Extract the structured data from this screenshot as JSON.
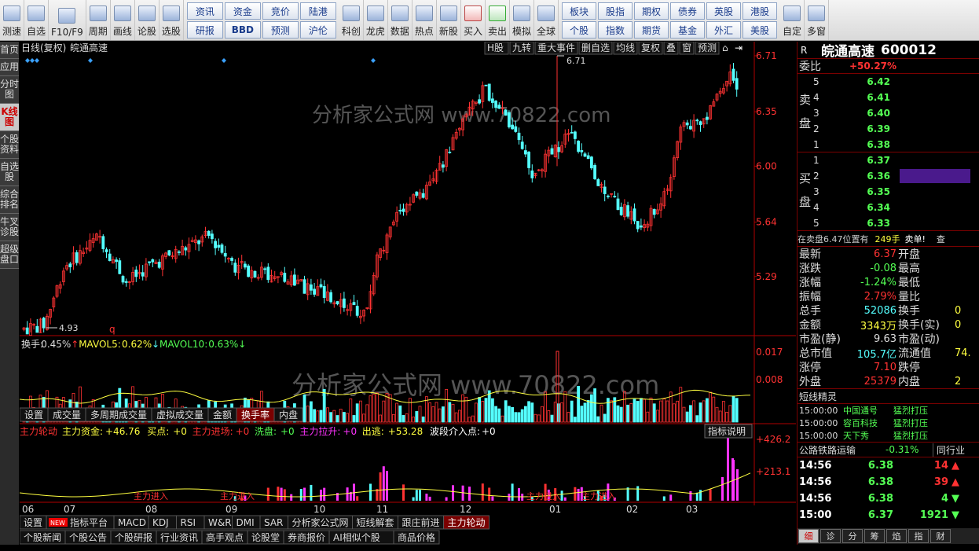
{
  "toolbar": {
    "left_buttons": [
      {
        "label": "测速",
        "icon": "speed-test-icon"
      },
      {
        "label": "自选",
        "icon": "star-icon"
      },
      {
        "label": "F10/F9",
        "icon": "document-icon"
      },
      {
        "label": "周期",
        "icon": "clock-icon"
      },
      {
        "label": "画线",
        "icon": "pencil-icon"
      },
      {
        "label": "论股",
        "icon": "discussion-icon"
      },
      {
        "label": "选股",
        "icon": "stock-picker-icon"
      }
    ],
    "grid1": [
      "资讯",
      "资金",
      "竞价",
      "陆港",
      "研报",
      "BBD",
      "预测",
      "沪伦"
    ],
    "mid_buttons": [
      {
        "label": "科创",
        "icon": "kechuang-icon"
      },
      {
        "label": "龙虎",
        "icon": "dragon-tiger-icon"
      },
      {
        "label": "数据",
        "icon": "pe-data-icon"
      },
      {
        "label": "热点",
        "icon": "hot-icon"
      },
      {
        "label": "新股",
        "icon": "ipo-icon"
      },
      {
        "label": "买入",
        "icon": "buy-icon"
      },
      {
        "label": "卖出",
        "icon": "sell-icon"
      },
      {
        "label": "模拟",
        "icon": "hammer-icon"
      },
      {
        "label": "全球",
        "icon": "globe-icon"
      }
    ],
    "grid2": [
      "板块",
      "股指",
      "期权",
      "债券",
      "英股",
      "港股",
      "个股",
      "指数",
      "期货",
      "基金",
      "外汇",
      "美股"
    ],
    "right_buttons": [
      {
        "label": "自定",
        "icon": "customize-icon"
      },
      {
        "label": "多窗",
        "icon": "multi-window-icon"
      }
    ]
  },
  "left_tabs": [
    "首页",
    "应用",
    "分时图",
    "K线图",
    "个股资料",
    "自选股",
    "综合排名",
    "牛叉诊股",
    "超级盘口"
  ],
  "chart": {
    "title": "日线(复权)",
    "stock": "皖通高速",
    "top_menu": [
      "H股",
      "九转",
      "重大事件",
      "删自选",
      "均线",
      "复权",
      "叠",
      "窗",
      "预测"
    ],
    "watermark": "分析家公式网 www.70822.com",
    "price_axis": [
      "6.71",
      "6.35",
      "6.00",
      "5.64",
      "5.29"
    ],
    "high_label": "6.71",
    "low_label": "4.93",
    "low_marker": "q",
    "months": [
      "06",
      "07",
      "08",
      "09",
      "10",
      "11",
      "12",
      "01",
      "02",
      "03"
    ],
    "vol_legend": {
      "label": "换手:",
      "value": "0.45%",
      "ma5_label": "MAVOL5:",
      "ma5": "0.62%",
      "ma10_label": "MAVOL10:",
      "ma10": "0.63%"
    },
    "vol_axis": [
      "0.017",
      "0.008"
    ],
    "vol_tabs": [
      "设置",
      "成交量",
      "多周期成交量",
      "虚拟成交量",
      "金额",
      "换手率",
      "内盘"
    ],
    "vol_active": "换手率",
    "ind_legend": {
      "name": "主力轮动",
      "items": [
        {
          "k": "主力资金:",
          "v": "+46.76"
        },
        {
          "k": "买点:",
          "v": "+0"
        },
        {
          "k": "主力进场:",
          "v": "+0"
        },
        {
          "k": "洗盘:",
          "v": "+0"
        },
        {
          "k": "主力拉升:",
          "v": "+0"
        },
        {
          "k": "出逃:",
          "v": "+53.28"
        },
        {
          "k": "波段介入点:",
          "v": "+0"
        }
      ]
    },
    "ind_button": "指标说明",
    "ind_axis": [
      "+426.2",
      "+213.1"
    ],
    "ind_marks": [
      "主力进入",
      "主力进入",
      "主力进入",
      "主力进入"
    ],
    "ind_tabs": [
      "设置",
      "指标平台",
      "MACD",
      "KDJ",
      "RSI",
      "W&R",
      "DMI",
      "SAR",
      "分析家公式网",
      "短线解套",
      "跟庄前进",
      "主力轮动"
    ],
    "ind_new_badge": "NEW",
    "ind_active": "主力轮动",
    "news_tabs": [
      "个股新闻",
      "个股公告",
      "个股研报",
      "行业资讯",
      "高手观点",
      "论股堂",
      "券商报价",
      "AI相似个股",
      "商品价格"
    ],
    "chart_data": {
      "type": "candlestick",
      "price_range": [
        4.93,
        6.71
      ]
    }
  },
  "quote": {
    "code_prefix": "R",
    "name": "皖通高速",
    "code": "600012",
    "weibi_label": "委比",
    "weibi": "+50.27%",
    "sell_label": "卖盘",
    "buy_label": "买盘",
    "sell": [
      {
        "lvl": "5",
        "price": "6.42"
      },
      {
        "lvl": "4",
        "price": "6.41"
      },
      {
        "lvl": "3",
        "price": "6.40"
      },
      {
        "lvl": "2",
        "price": "6.39"
      },
      {
        "lvl": "1",
        "price": "6.38"
      }
    ],
    "buy": [
      {
        "lvl": "1",
        "price": "6.37"
      },
      {
        "lvl": "2",
        "price": "6.36"
      },
      {
        "lvl": "3",
        "price": "6.35"
      },
      {
        "lvl": "4",
        "price": "6.34"
      },
      {
        "lvl": "5",
        "price": "6.33"
      }
    ],
    "position_line": "在卖盘6.47位置有",
    "position_qty": "249手",
    "position_tag": "卖单!",
    "position_more": "查",
    "stats": [
      {
        "k": "最新",
        "v": "6.37",
        "k2": "开盘",
        "v2": ""
      },
      {
        "k": "涨跌",
        "v": "-0.08",
        "k2": "最高",
        "v2": ""
      },
      {
        "k": "涨幅",
        "v": "-1.24%",
        "k2": "最低",
        "v2": ""
      },
      {
        "k": "振幅",
        "v": "2.79%",
        "k2": "量比",
        "v2": ""
      },
      {
        "k": "总手",
        "v": "52086",
        "k2": "换手",
        "v2": "0"
      },
      {
        "k": "金额",
        "v": "3343万",
        "k2": "换手(实)",
        "v2": "0"
      },
      {
        "k": "市盈(静)",
        "v": "9.63",
        "k2": "市盈(动)",
        "v2": ""
      },
      {
        "k": "总市值",
        "v": "105.7亿",
        "k2": "流通值",
        "v2": "74."
      },
      {
        "k": "涨停",
        "v": "7.10",
        "k2": "跌停",
        "v2": ""
      },
      {
        "k": "外盘",
        "v": "25379",
        "k2": "内盘",
        "v2": "2"
      }
    ],
    "short_title": "短线精灵",
    "short_items": [
      {
        "time": "15:00:00",
        "name": "中国通号",
        "action": "猛烈打压"
      },
      {
        "time": "15:00:00",
        "name": "容百科技",
        "action": "猛烈打压"
      },
      {
        "time": "15:00:00",
        "name": "天下秀",
        "action": "猛烈打压"
      }
    ],
    "industry": "公路铁路运输",
    "industry_chg": "-0.31%",
    "industry_btn": "同行业",
    "ticks": [
      {
        "time": "14:56",
        "price": "6.38",
        "vol": "14",
        "dir": "up"
      },
      {
        "time": "14:56",
        "price": "6.38",
        "vol": "39",
        "dir": "up"
      },
      {
        "time": "14:56",
        "price": "6.38",
        "vol": "4",
        "dir": "down"
      },
      {
        "time": "15:00",
        "price": "6.37",
        "vol": "1921",
        "dir": "down"
      }
    ],
    "bottom_tabs": [
      "细",
      "诊",
      "分",
      "筹",
      "焰",
      "指",
      "财"
    ]
  },
  "colors": {
    "up": "#ff3232",
    "down": "#54ffff",
    "ma": "#ffff40",
    "magenta": "#ff33ff",
    "axis_red": "#b00000"
  }
}
